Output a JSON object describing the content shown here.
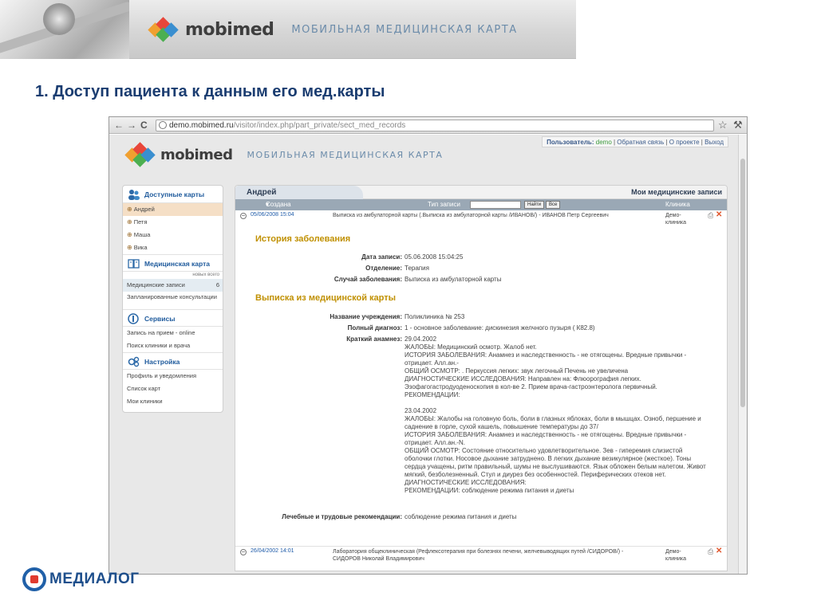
{
  "banner": {
    "brand": "mobimed",
    "subtitle": "МОБИЛЬНАЯ МЕДИЦИНСКАЯ КАРТА"
  },
  "slide": {
    "title": "1. Доступ пациента к данным его мед.карты"
  },
  "browser": {
    "url_host": "demo.mobimed.ru",
    "url_path": "/visitor/index.php/part_private/sect_med_records"
  },
  "site": {
    "brand": "mobimed",
    "subtitle": "МОБИЛЬНАЯ МЕДИЦИНСКАЯ КАРТА",
    "user_label": "Пользователь:",
    "user_name": "demo",
    "links": [
      "Обратная связь",
      "О проекте",
      "Выход"
    ]
  },
  "sidebar": {
    "cards_title": "Доступные карты",
    "patients": [
      "Андрей",
      "Петя",
      "Маша",
      "Вика"
    ],
    "medcard_title": "Медицинская карта",
    "new_total": "новых всего",
    "med_records": "Медицинские записи",
    "med_records_count": "6",
    "planned": "Запланированные консультации",
    "services_title": "Сервисы",
    "services": [
      "Запись на прием - online",
      "Поиск клиники и врача"
    ],
    "settings_title": "Настройка",
    "settings": [
      "Профиль и уведомления",
      "Список карт",
      "Мои клиники"
    ]
  },
  "main": {
    "tab_name": "Андрей",
    "tab_right": "Мои медицинские записи",
    "col_created": "Создана",
    "col_type": "Тип записи",
    "btn_find": "Найти",
    "btn_all": "Все",
    "col_clinic": "Клиника",
    "record1": {
      "date": "05/06/2008 15:04",
      "desc": "Выписка из амбулаторной карты (.Выписка из амбулаторной карты /ИВАНОВ/) - ИВАНОВ Петр Сергеевич",
      "clinic": "Демо-клиника"
    },
    "history_title": "История заболевания",
    "rec_date_k": "Дата записи:",
    "rec_date_v": "05.06.2008 15:04:25",
    "dept_k": "Отделение:",
    "dept_v": "Терапия",
    "case_k": "Случай заболевания:",
    "case_v": "Выписка из амбулаторной карты",
    "extract_title": "Выписка из медицинской карты",
    "inst_k": "Название учреждения:",
    "inst_v": "Поликлиника № 253",
    "diag_k": "Полный диагноз:",
    "diag_v": "1 - основное заболевание: дискинезия желчного пузыря ( К82.8)",
    "anam_k": "Краткий анамнез:",
    "anamnesis": [
      "29.04.2002",
      "ЖАЛОБЫ: Медицинский осмотр. Жалоб нет.",
      "ИСТОРИЯ ЗАБОЛЕВАНИЯ: Анамнез и наследственность - не отягощены. Вредные привычки - отрицает. Алл.ан.-",
      "ОБЩИЙ ОСМОТР: . Перкуссия легких: звук легочный Печень не увеличена",
      "ДИАГНОСТИЧЕСКИЕ ИССЛЕДОВАНИЯ: Направлен на: Флюорография легких. Эзофагогастродуоденоскопия в кол-ве 2. Прием врача-гастроэнтеролога первичный.",
      "РЕКОМЕНДАЦИИ:",
      "",
      "23.04.2002",
      "ЖАЛОБЫ: Жалобы на головную боль, боли в глазных яблоках, боли в мышцах. Озноб, першение и саднение в горле, сухой кашель, повышение температуры до 37/",
      "ИСТОРИЯ ЗАБОЛЕВАНИЯ: Анамнез и наследственность - не отягощены. Вредные привычки - отрицает. Алл.ан.-N.",
      "ОБЩИЙ ОСМОТР: Состояние относительно удовлетворительное. Зев - гиперемия слизистой оболочки глотки. Носовое дыхание затруднено. В легких дыхание везикулярное (жесткое). Тоны сердца учащены, ритм правильный, шумы не выслушиваются. Язык обложен белым налетом. Живот мягкий, безболезненный. Стул и диурез без особенностей. Периферических отеков нет.",
      "ДИАГНОСТИЧЕСКИЕ ИССЛЕДОВАНИЯ:",
      "РЕКОМЕНДАЦИИ: соблюдение режима питания и диеты"
    ],
    "reco_k": "Лечебные и трудовые рекомендации:",
    "reco_v": "соблюдение режима питания и диеты",
    "record2": {
      "date": "26/04/2002 14:01",
      "desc": "Лаборатория общеклиническая (Рефлексотерапия при болезнях печени, желчевыводящих путей /СИДОРОВ/) - СИДОРОВ Николай Владимирович",
      "clinic": "Демо-клиника"
    }
  },
  "footer": {
    "brand": "МЕДИАЛОГ"
  },
  "colors": {
    "title": "#1a3c70",
    "section": "#c09000",
    "link": "#1d5aa8",
    "delete": "#e0552b"
  }
}
